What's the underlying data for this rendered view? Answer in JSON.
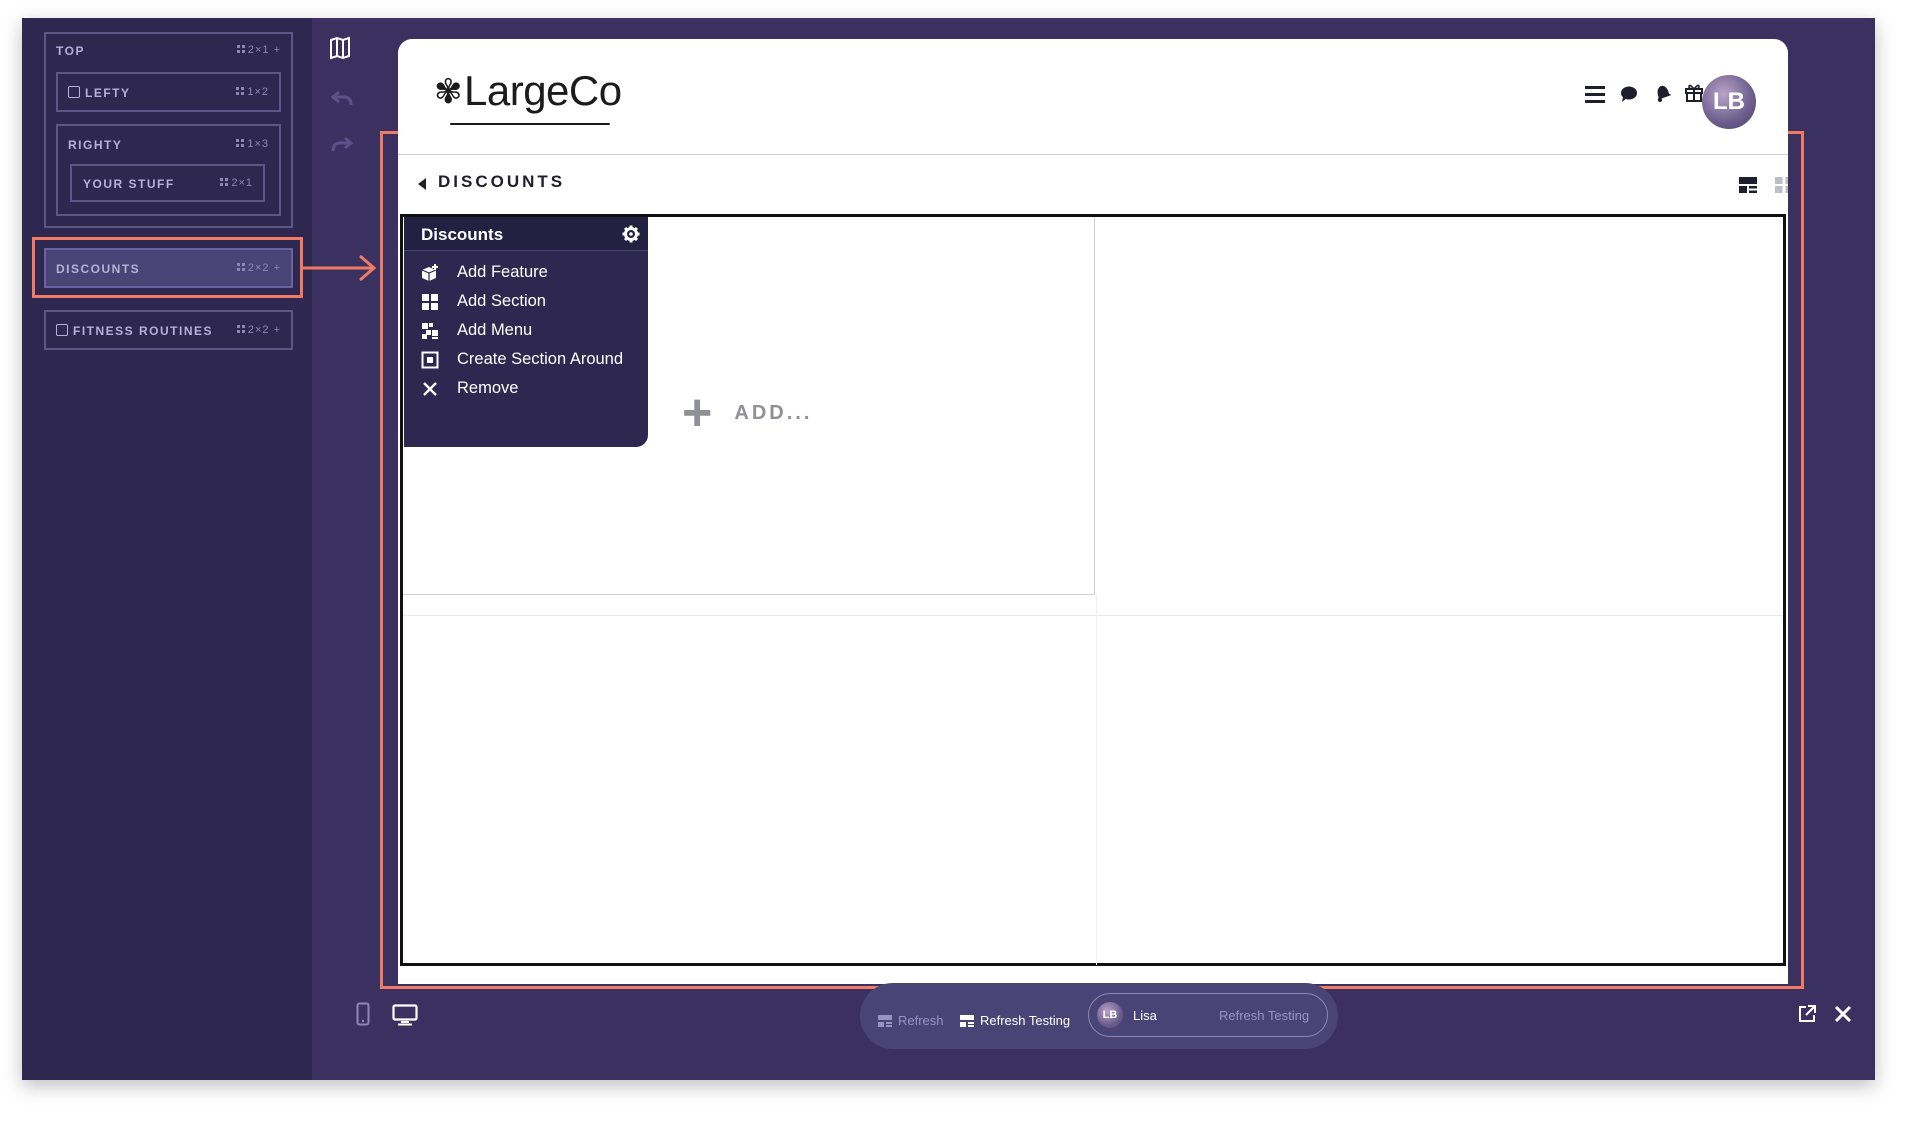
{
  "sidebar": {
    "top": {
      "title": "TOP",
      "meta": "2×1 +"
    },
    "lefty": {
      "title": "LEFTY",
      "meta": "1×2"
    },
    "righty": {
      "title": "RIGHTY",
      "meta": "1×3"
    },
    "your_stuff": {
      "title": "YOUR STUFF",
      "meta": "2×1"
    },
    "discounts": {
      "title": "DISCOUNTS",
      "meta": "2×2 +"
    },
    "fitness": {
      "title": "FITNESS ROUTINES",
      "meta": "2×2 +"
    }
  },
  "header": {
    "logo_text": "LargeCo",
    "avatar_initials": "LB"
  },
  "section": {
    "title": "DISCOUNTS"
  },
  "placeholder": {
    "add_label": "ADD..."
  },
  "menu": {
    "title": "Discounts",
    "items": [
      {
        "label": "Add Feature",
        "icon": "add-feature-icon"
      },
      {
        "label": "Add Section",
        "icon": "add-section-icon"
      },
      {
        "label": "Add Menu",
        "icon": "add-menu-icon"
      },
      {
        "label": "Create Section Around",
        "icon": "create-section-around-icon"
      },
      {
        "label": "Remove",
        "icon": "remove-icon"
      }
    ]
  },
  "footer": {
    "refresh_label": "Refresh",
    "refresh_testing_label": "Refresh Testing",
    "user_initials": "LB",
    "user_name": "Lisa",
    "user_env": "Refresh Testing"
  },
  "colors": {
    "app_bg": "#3a3160",
    "sidebar_bg": "#2e2750",
    "highlight": "#ef7b64",
    "menu_bg": "#2e2750"
  }
}
